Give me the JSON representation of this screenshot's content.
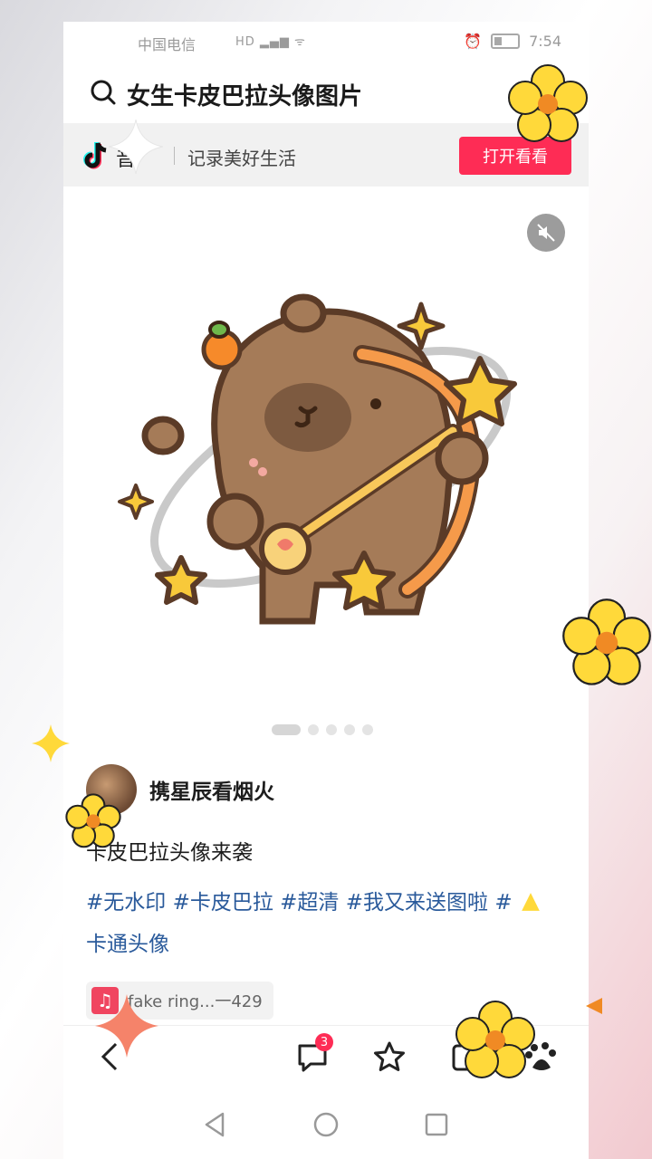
{
  "status_bar": {
    "carrier": "中国电信",
    "time": "7:54"
  },
  "search": {
    "query": "女生卡皮巴拉头像图片"
  },
  "app_banner": {
    "app_name": "音",
    "slogan": "记录美好生活",
    "open_button": "打开看看"
  },
  "media": {
    "pager_total": 5,
    "pager_active": 1
  },
  "post": {
    "author": "携星辰看烟火",
    "caption": "卡皮巴拉头像来袭",
    "tags_line1": "#无水印 #卡皮巴拉 #超清 #我又来送图啦 #",
    "tags_line2": "卡通头像",
    "music": "fake ring...一429"
  },
  "bottom_bar": {
    "comment_badge": "3"
  },
  "colors": {
    "accent": "#fe2c55",
    "tag": "#2a5a9b",
    "flower": "#ffd93a",
    "flower_center": "#f08a24"
  },
  "icons": [
    "search-icon",
    "tiktok-logo-icon",
    "mute-icon",
    "music-note-icon",
    "back-icon",
    "comment-icon",
    "star-icon",
    "share-icon",
    "baidu-paw-icon",
    "nav-back-icon",
    "nav-home-icon",
    "nav-recent-icon"
  ]
}
